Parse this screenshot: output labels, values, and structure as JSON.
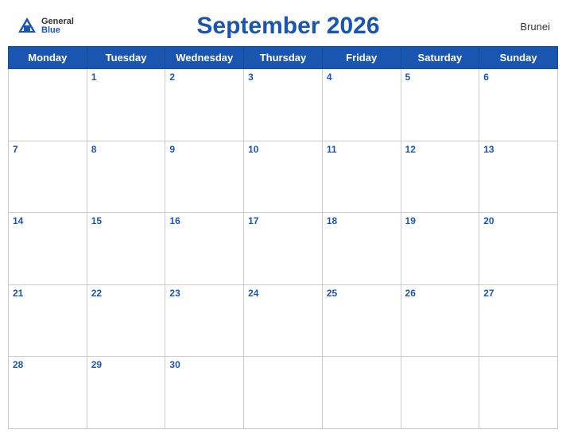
{
  "header": {
    "title": "September 2026",
    "country": "Brunei",
    "logo_general": "General",
    "logo_blue": "Blue"
  },
  "weekdays": [
    "Monday",
    "Tuesday",
    "Wednesday",
    "Thursday",
    "Friday",
    "Saturday",
    "Sunday"
  ],
  "weeks": [
    [
      null,
      1,
      2,
      3,
      4,
      5,
      6
    ],
    [
      7,
      8,
      9,
      10,
      11,
      12,
      13
    ],
    [
      14,
      15,
      16,
      17,
      18,
      19,
      20
    ],
    [
      21,
      22,
      23,
      24,
      25,
      26,
      27
    ],
    [
      28,
      29,
      30,
      null,
      null,
      null,
      null
    ]
  ]
}
